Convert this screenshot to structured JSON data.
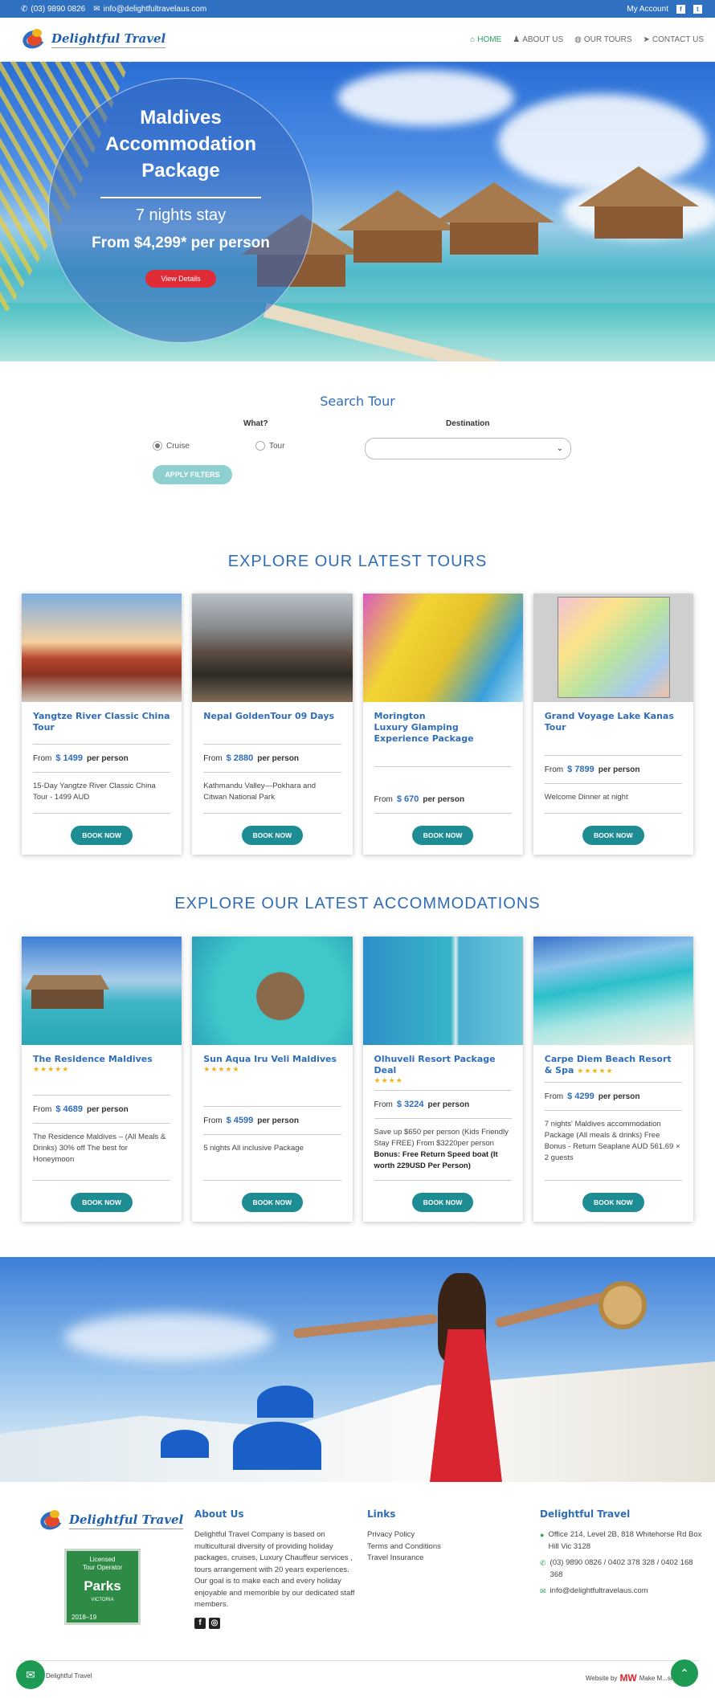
{
  "topbar": {
    "phone": "(03) 9890 0826",
    "email": "info@delightfultravelaus.com",
    "account": "My Account"
  },
  "brand": {
    "name": "Delightful Travel"
  },
  "nav": [
    {
      "label": "HOME",
      "icon": "home-icon"
    },
    {
      "label": "ABOUT US",
      "icon": "user-icon"
    },
    {
      "label": "OUR TOURS",
      "icon": "globe-icon"
    },
    {
      "label": "CONTACT US",
      "icon": "send-icon"
    }
  ],
  "hero": {
    "title": "Maldives Accommodation Package",
    "nights": "7 nights stay",
    "price": "From $4,299* per person",
    "cta": "View Details"
  },
  "search": {
    "title": "Search Tour",
    "what_label": "What?",
    "destination_label": "Destination",
    "options": [
      "Cruise",
      "Tour"
    ],
    "selected": "Cruise",
    "destination_value": "",
    "apply": "APPLY FILTERS"
  },
  "tours": {
    "title": "EXPLORE OUR LATEST TOURS",
    "items": [
      {
        "title": "Yangtze River Classic China Tour",
        "from": "From",
        "amount": "$ 1499",
        "per": "per person",
        "desc": "15-Day Yangtze River Classic China Tour - 1499 AUD",
        "cta": "BOOK NOW"
      },
      {
        "title": "Nepal GoldenTour 09 Days",
        "from": "From",
        "amount": "$ 2880",
        "per": "per person",
        "desc": "Kathmandu Valley—Pokhara  and Citwan National Park",
        "cta": "BOOK NOW"
      },
      {
        "title": "Morington\nLuxury Glamping Experience Package",
        "from": "From",
        "amount": "$ 670",
        "per": "per person",
        "desc": "",
        "cta": "BOOK NOW"
      },
      {
        "title": "Grand Voyage Lake Kanas Tour",
        "from": "From",
        "amount": "$ 7899",
        "per": "per person",
        "desc": "Welcome Dinner at night",
        "cta": "BOOK NOW"
      }
    ]
  },
  "accommodations": {
    "title": "EXPLORE OUR LATEST ACCOMMODATIONS",
    "items": [
      {
        "title": "The Residence Maldives",
        "stars": "★★★★★",
        "from": "From",
        "amount": "$ 4689",
        "per": "per person",
        "desc": "The Residence Maldives – (All Meals & Drinks) 30% off The best for Honeymoon",
        "bold": "",
        "cta": "BOOK NOW"
      },
      {
        "title": "Sun Aqua Iru Veli Maldives",
        "stars": "★★★★★",
        "from": "From",
        "amount": "$ 4599",
        "per": "per person",
        "desc": "5 nights All inclusive Package",
        "bold": "",
        "cta": "BOOK NOW"
      },
      {
        "title": "Olhuveli Resort Package Deal",
        "stars": "★★★★",
        "from": "From",
        "amount": "$ 3224",
        "per": "per person",
        "desc": "Save up $650 per person (Kids Friendly Stay FREE) From $3220per person",
        "bold": "Bonus: Free Return Speed boat (It worth 229USD Per Person)",
        "cta": "BOOK NOW"
      },
      {
        "title": "Carpe Diem Beach Resort & Spa",
        "stars": "★★★★★",
        "from": "From",
        "amount": "$ 4299",
        "per": "per person",
        "desc": "7 nights' Maldives accommodation Package (All meals & drinks) Free Bonus - Return Seaplane AUD 561.69 × 2 guests",
        "bold": "",
        "cta": "BOOK NOW"
      }
    ]
  },
  "footer": {
    "brand": "Delightful Travel",
    "parks": {
      "line1": "Licensed",
      "line2": "Tour Operator",
      "logo": "Parks",
      "sub": "VICTORIA",
      "year": "2018–19"
    },
    "about_title": "About Us",
    "about_text": "Delightful Travel Company is based on multicultural diversity of providing holiday packages, cruises, Luxury Chauffeur services , tours arrangement with 20 years experiences. Our goal is to make each and every holiday enjoyable and memorible by our dedicated staff members.",
    "links_title": "Links",
    "links": [
      "Privacy Policy",
      "Terms and Conditions",
      "Travel Insurance"
    ],
    "contact_title": "Delightful Travel",
    "address": "Office 214, Level 2B, 818 Whitehorse Rd Box Hill Vic 3128",
    "phones": "(03) 9890 0826 / 0402 378 328 / 0402 168 368",
    "email": "info@delightfultravelaus.com",
    "copyright": "Delightful Travel",
    "credit_prefix": "Website by",
    "credit_brand": "MW",
    "credit_suffix": "Make M...site"
  },
  "colors": {
    "primary": "#2f70c0",
    "accent": "#2aa563",
    "cta_red": "#e02c37",
    "book_teal": "#1d8d93"
  }
}
